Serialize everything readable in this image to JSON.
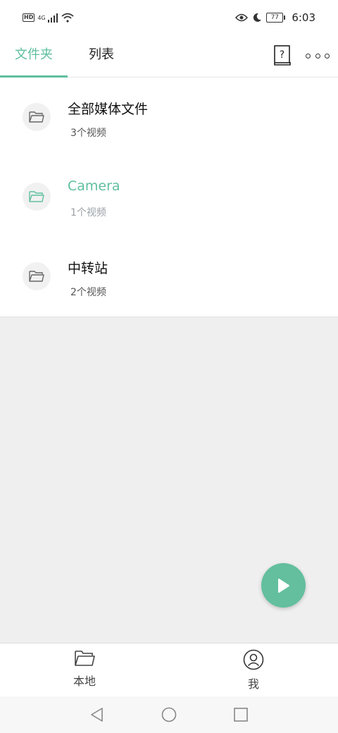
{
  "status_bar": {
    "hd_label": "HD",
    "network_label": "4G",
    "battery_level": "77",
    "time": "6:03"
  },
  "top_bar": {
    "tabs": [
      {
        "label": "文件夹",
        "active": true
      },
      {
        "label": "列表",
        "active": false
      }
    ],
    "help_icon": "help-book-icon",
    "more_icon": "more-dots-icon"
  },
  "folders": [
    {
      "name": "全部媒体文件",
      "count": "3个视频",
      "active": false
    },
    {
      "name": "Camera",
      "count": "1个视频",
      "active": true
    },
    {
      "name": "中转站",
      "count": "2个视频",
      "active": false
    }
  ],
  "fab": {
    "icon": "play-icon",
    "color": "#63bf9e"
  },
  "bottom_nav": [
    {
      "label": "本地",
      "icon": "folder-icon"
    },
    {
      "label": "我",
      "icon": "user-icon"
    }
  ],
  "colors": {
    "accent": "#5fbf9f",
    "background_gray": "#efefef"
  }
}
